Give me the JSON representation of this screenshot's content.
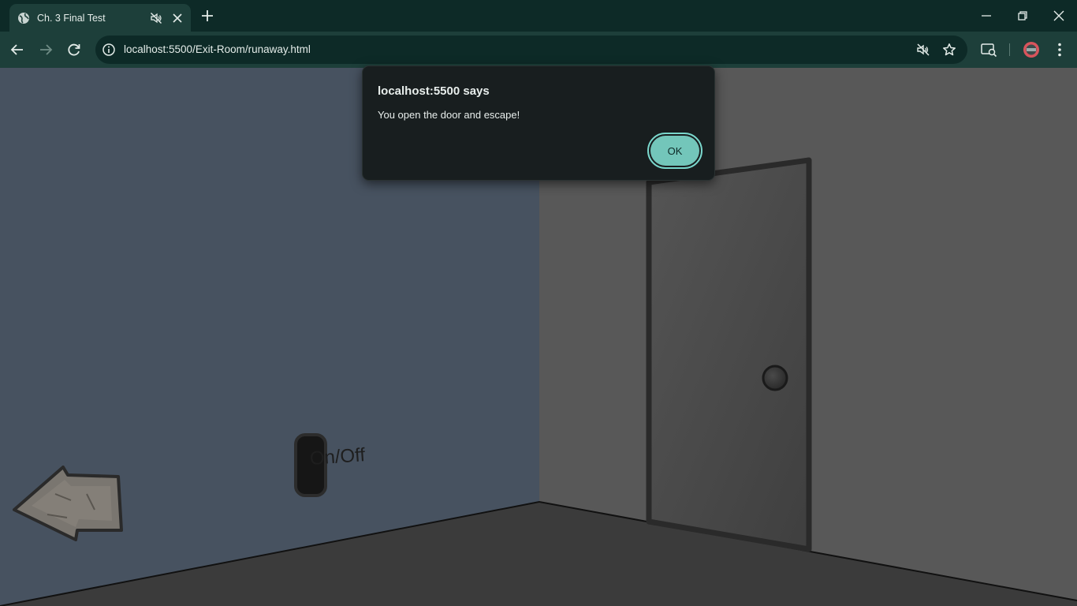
{
  "browser": {
    "tab": {
      "title": "Ch. 3 Final Test"
    },
    "address": {
      "url": "localhost:5500/Exit-Room/runaway.html"
    }
  },
  "scene": {
    "switch_label": "On/Off",
    "colors": {
      "left_wall": "#475260",
      "right_wall": "#585858",
      "floor": "#3b3b3b",
      "door": "#4a4a4a",
      "door_frame": "#2a2a2a"
    }
  },
  "dialog": {
    "title": "localhost:5500 says",
    "message": "You open the door and escape!",
    "ok_label": "OK"
  }
}
